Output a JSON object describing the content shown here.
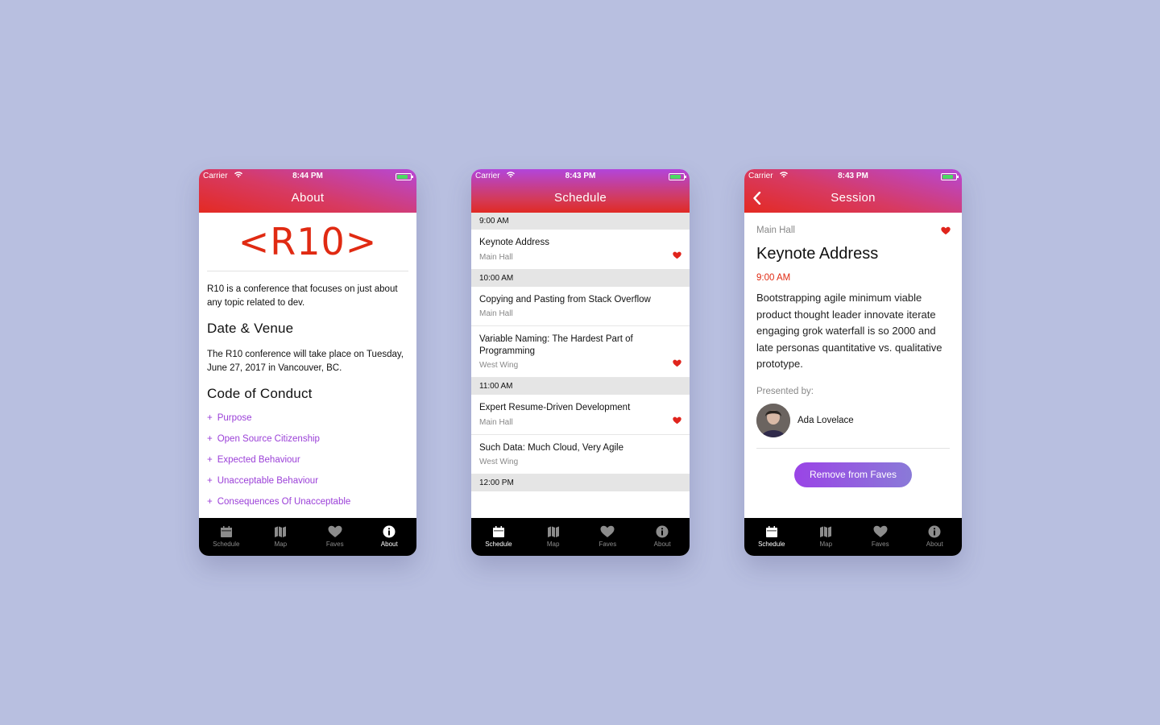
{
  "colors": {
    "background": "#b8bfe0",
    "accent_red": "#e02a12",
    "accent_purple": "#9b40d8",
    "heart": "#e0241c"
  },
  "status": {
    "carrier": "Carrier"
  },
  "tabs": [
    {
      "label": "Schedule",
      "icon": "calendar-icon"
    },
    {
      "label": "Map",
      "icon": "map-icon"
    },
    {
      "label": "Faves",
      "icon": "heart-icon"
    },
    {
      "label": "About",
      "icon": "info-icon"
    }
  ],
  "about": {
    "time": "8:44 PM",
    "title": "About",
    "logo": "<R10>",
    "intro": "R10 is a conference that focuses on just about any topic related to dev.",
    "date_venue_heading": "Date & Venue",
    "date_venue_text": "The R10 conference will take place on Tuesday, June 27, 2017 in Vancouver, BC.",
    "coc_heading": "Code of Conduct",
    "coc_items": [
      "Purpose",
      "Open Source Citizenship",
      "Expected Behaviour",
      "Unacceptable Behaviour",
      "Consequences Of Unacceptable"
    ],
    "active_tab": "About"
  },
  "schedule": {
    "time": "8:43 PM",
    "title": "Schedule",
    "groups": [
      {
        "time": "9:00 AM",
        "sessions": [
          {
            "title": "Keynote Address",
            "location": "Main Hall",
            "faved": true
          }
        ]
      },
      {
        "time": "10:00 AM",
        "sessions": [
          {
            "title": "Copying and Pasting from Stack Overflow",
            "location": "Main Hall",
            "faved": false
          },
          {
            "title": "Variable Naming: The Hardest Part of Programming",
            "location": "West Wing",
            "faved": true
          }
        ]
      },
      {
        "time": "11:00 AM",
        "sessions": [
          {
            "title": "Expert Resume-Driven Development",
            "location": "Main Hall",
            "faved": true
          },
          {
            "title": "Such Data: Much Cloud, Very Agile",
            "location": "West Wing",
            "faved": false
          }
        ]
      },
      {
        "time": "12:00 PM",
        "sessions": []
      }
    ],
    "active_tab": "Schedule"
  },
  "session": {
    "time": "8:43 PM",
    "title": "Session",
    "location": "Main Hall",
    "name": "Keynote Address",
    "start": "9:00 AM",
    "description": "Bootstrapping agile minimum viable product thought leader innovate iterate engaging grok waterfall is so 2000 and late personas quantitative vs. qualitative prototype.",
    "presented_by": "Presented by:",
    "speaker": "Ada Lovelace",
    "button": "Remove from Faves",
    "active_tab": "Schedule"
  }
}
